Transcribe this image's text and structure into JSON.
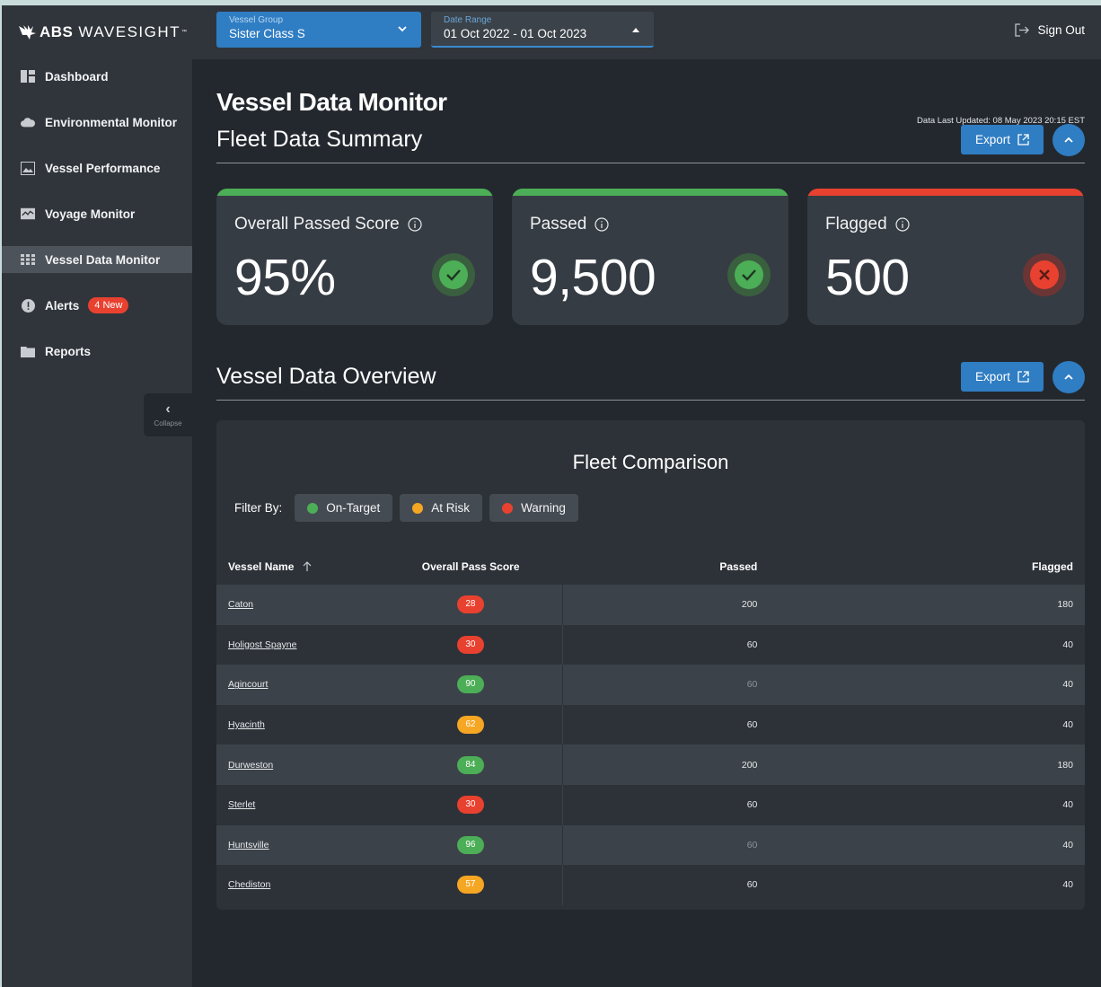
{
  "app": {
    "logo_brand": "ABS",
    "logo_product": "WAVESIGHT",
    "logo_tm": "™"
  },
  "sidebar": {
    "items": [
      {
        "label": "Dashboard",
        "icon": "dashboard-icon"
      },
      {
        "label": "Environmental Monitor",
        "icon": "cloud-icon"
      },
      {
        "label": "Vessel Performance",
        "icon": "image-icon"
      },
      {
        "label": "Voyage Monitor",
        "icon": "chart-icon"
      },
      {
        "label": "Vessel Data Monitor",
        "icon": "grid-icon",
        "active": true
      },
      {
        "label": "Alerts",
        "icon": "alert-icon",
        "badge": "4 New"
      },
      {
        "label": "Reports",
        "icon": "folder-icon"
      }
    ],
    "collapse_label": "Collapse"
  },
  "topbar": {
    "vessel_group": {
      "label": "Vessel Group",
      "value": "Sister Class S"
    },
    "date_range": {
      "label": "Date Range",
      "value": "01 Oct 2022 - 01 Oct 2023"
    },
    "sign_out": "Sign Out"
  },
  "page": {
    "title": "Vessel Data Monitor",
    "updated": "Data Last Updated: 08 May 2023 20:15 EST"
  },
  "summary": {
    "title": "Fleet Data Summary",
    "export_label": "Export",
    "cards": [
      {
        "label": "Overall Passed Score",
        "value": "95%",
        "status": "ok"
      },
      {
        "label": "Passed",
        "value": "9,500",
        "status": "ok"
      },
      {
        "label": "Flagged",
        "value": "500",
        "status": "bad"
      }
    ]
  },
  "overview": {
    "title": "Vessel Data Overview",
    "export_label": "Export",
    "panel_title": "Fleet Comparison",
    "filter_label": "Filter By:",
    "filters": [
      {
        "label": "On-Target",
        "color": "#4cae56"
      },
      {
        "label": "At Risk",
        "color": "#f5a623"
      },
      {
        "label": "Warning",
        "color": "#e8412f"
      }
    ],
    "columns": {
      "name": "Vessel Name",
      "score": "Overall Pass Score",
      "passed": "Passed",
      "flagged": "Flagged"
    },
    "rows": [
      {
        "name": "Caton",
        "score": "28",
        "level": "warning",
        "passed": "200",
        "flagged": "180",
        "passed_dim": false
      },
      {
        "name": "Holigost Spayne",
        "score": "30",
        "level": "warning",
        "passed": "60",
        "flagged": "40",
        "passed_dim": false
      },
      {
        "name": "Agincourt",
        "score": "90",
        "level": "on-target",
        "passed": "60",
        "flagged": "40",
        "passed_dim": true
      },
      {
        "name": "Hyacinth",
        "score": "62",
        "level": "at-risk",
        "passed": "60",
        "flagged": "40",
        "passed_dim": false
      },
      {
        "name": "Durweston",
        "score": "84",
        "level": "on-target",
        "passed": "200",
        "flagged": "180",
        "passed_dim": false
      },
      {
        "name": "Sterlet",
        "score": "30",
        "level": "warning",
        "passed": "60",
        "flagged": "40",
        "passed_dim": false
      },
      {
        "name": "Huntsville",
        "score": "96",
        "level": "on-target",
        "passed": "60",
        "flagged": "40",
        "passed_dim": true
      },
      {
        "name": "Chediston",
        "score": "57",
        "level": "at-risk",
        "passed": "60",
        "flagged": "40",
        "passed_dim": false
      }
    ]
  },
  "colors": {
    "on-target": "#4cae56",
    "at-risk": "#f5a623",
    "warning": "#e8412f",
    "accent": "#2f7dc3"
  }
}
